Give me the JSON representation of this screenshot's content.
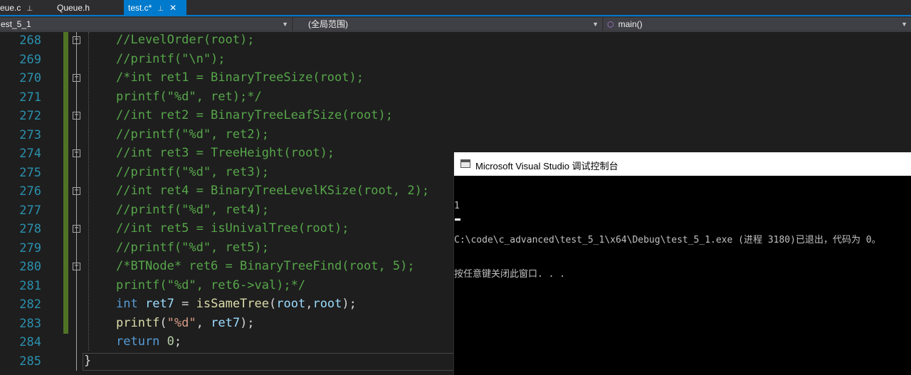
{
  "tabs": [
    {
      "label": "eue.c",
      "pin": "⊥",
      "active": false
    },
    {
      "label": "Queue.h",
      "pin": "",
      "active": false
    },
    {
      "label": "test.c*",
      "pin": "⊥",
      "close": "✕",
      "active": true
    }
  ],
  "nav": {
    "project": "est_5_1",
    "scope": "(全局范围)",
    "member": "main()"
  },
  "editor": {
    "lines": [
      {
        "num": "268",
        "fold": "−",
        "tokens": [
          {
            "c": "cm",
            "t": "//LevelOrder(root);"
          }
        ]
      },
      {
        "num": "269",
        "fold": "",
        "tokens": [
          {
            "c": "cm",
            "t": "//printf(\"\\n\");"
          }
        ]
      },
      {
        "num": "270",
        "fold": "−",
        "tokens": [
          {
            "c": "cm",
            "t": "/*int ret1 = BinaryTreeSize(root);"
          }
        ]
      },
      {
        "num": "271",
        "fold": "",
        "tokens": [
          {
            "c": "cm",
            "t": "printf(\"%d\", ret);*/"
          }
        ]
      },
      {
        "num": "272",
        "fold": "−",
        "tokens": [
          {
            "c": "cm",
            "t": "//int ret2 = BinaryTreeLeafSize(root);"
          }
        ]
      },
      {
        "num": "273",
        "fold": "",
        "tokens": [
          {
            "c": "cm",
            "t": "//printf(\"%d\", ret2);"
          }
        ]
      },
      {
        "num": "274",
        "fold": "−",
        "tokens": [
          {
            "c": "cm",
            "t": "//int ret3 = TreeHeight(root);"
          }
        ]
      },
      {
        "num": "275",
        "fold": "",
        "tokens": [
          {
            "c": "cm",
            "t": "//printf(\"%d\", ret3);"
          }
        ]
      },
      {
        "num": "276",
        "fold": "−",
        "tokens": [
          {
            "c": "cm",
            "t": "//int ret4 = BinaryTreeLevelKSize(root, 2);"
          }
        ]
      },
      {
        "num": "277",
        "fold": "",
        "tokens": [
          {
            "c": "cm",
            "t": "//printf(\"%d\", ret4);"
          }
        ]
      },
      {
        "num": "278",
        "fold": "−",
        "tokens": [
          {
            "c": "cm",
            "t": "//int ret5 = isUnivalTree(root);"
          }
        ]
      },
      {
        "num": "279",
        "fold": "",
        "tokens": [
          {
            "c": "cm",
            "t": "//printf(\"%d\", ret5);"
          }
        ]
      },
      {
        "num": "280",
        "fold": "−",
        "tokens": [
          {
            "c": "cm",
            "t": "/*BTNode* ret6 = BinaryTreeFind(root, 5);"
          }
        ]
      },
      {
        "num": "281",
        "fold": "",
        "tokens": [
          {
            "c": "cm",
            "t": "printf(\"%d\", ret6->val);*/"
          }
        ]
      },
      {
        "num": "282",
        "fold": "",
        "tokens": [
          {
            "c": "kw",
            "t": "int"
          },
          {
            "c": "ty",
            "t": " "
          },
          {
            "c": "var",
            "t": "ret7"
          },
          {
            "c": "ty",
            "t": " = "
          },
          {
            "c": "fn",
            "t": "isSameTree"
          },
          {
            "c": "ty",
            "t": "("
          },
          {
            "c": "var",
            "t": "root"
          },
          {
            "c": "ty",
            "t": ","
          },
          {
            "c": "var",
            "t": "root"
          },
          {
            "c": "ty",
            "t": ");"
          }
        ]
      },
      {
        "num": "283",
        "fold": "",
        "tokens": [
          {
            "c": "fn",
            "t": "printf"
          },
          {
            "c": "ty",
            "t": "("
          },
          {
            "c": "str",
            "t": "\"%d\""
          },
          {
            "c": "ty",
            "t": ", "
          },
          {
            "c": "var",
            "t": "ret7"
          },
          {
            "c": "ty",
            "t": ");"
          }
        ]
      },
      {
        "num": "284",
        "fold": "",
        "tokens": [
          {
            "c": "kw",
            "t": "return"
          },
          {
            "c": "ty",
            "t": " "
          },
          {
            "c": "num",
            "t": "0"
          },
          {
            "c": "ty",
            "t": ";"
          }
        ]
      },
      {
        "num": "285",
        "fold": "",
        "tokens": [
          {
            "c": "ty",
            "t": "}"
          }
        ]
      }
    ]
  },
  "console": {
    "title": "Microsoft Visual Studio 调试控制台",
    "output": [
      "1",
      "C:\\code\\c_advanced\\test_5_1\\x64\\Debug\\test_5_1.exe (进程 3180)已退出，代码为 0。",
      "按任意键关闭此窗口. . ."
    ]
  }
}
